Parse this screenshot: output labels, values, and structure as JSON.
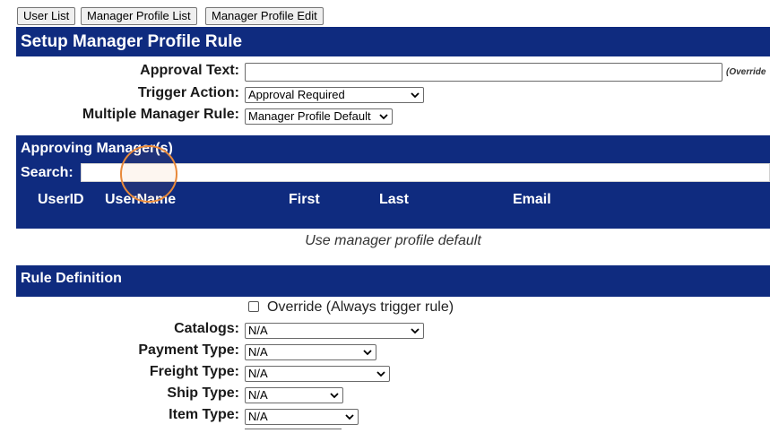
{
  "tabs": [
    "User List",
    "Manager Profile List",
    "Manager Profile Edit"
  ],
  "header": {
    "title": "Setup Manager Profile Rule"
  },
  "form": {
    "approval_text_label": "Approval Text:",
    "approval_text_value": "",
    "override_note": "(Override",
    "trigger_action_label": "Trigger Action:",
    "trigger_action_value": "Approval Required",
    "multiple_manager_label": "Multiple Manager Rule:",
    "multiple_manager_value": "Manager Profile Default"
  },
  "approving": {
    "title": "Approving Manager(s)",
    "search_label": "Search:",
    "search_value": "",
    "columns": [
      "UserID",
      "UserName",
      "First",
      "Last",
      "Email"
    ],
    "empty_message": "Use manager profile default"
  },
  "rule": {
    "title": "Rule Definition",
    "override_label": "Override (Always trigger rule)",
    "override_checked": false,
    "fields": [
      {
        "label": "Catalogs:",
        "value": "N/A"
      },
      {
        "label": "Payment Type:",
        "value": "N/A"
      },
      {
        "label": "Freight Type:",
        "value": "N/A"
      },
      {
        "label": "Ship Type:",
        "value": "N/A"
      },
      {
        "label": "Item Type:",
        "value": "N/A"
      }
    ]
  },
  "colors": {
    "band": "#0f2b7f",
    "cursor_ring": "#e8893a"
  }
}
